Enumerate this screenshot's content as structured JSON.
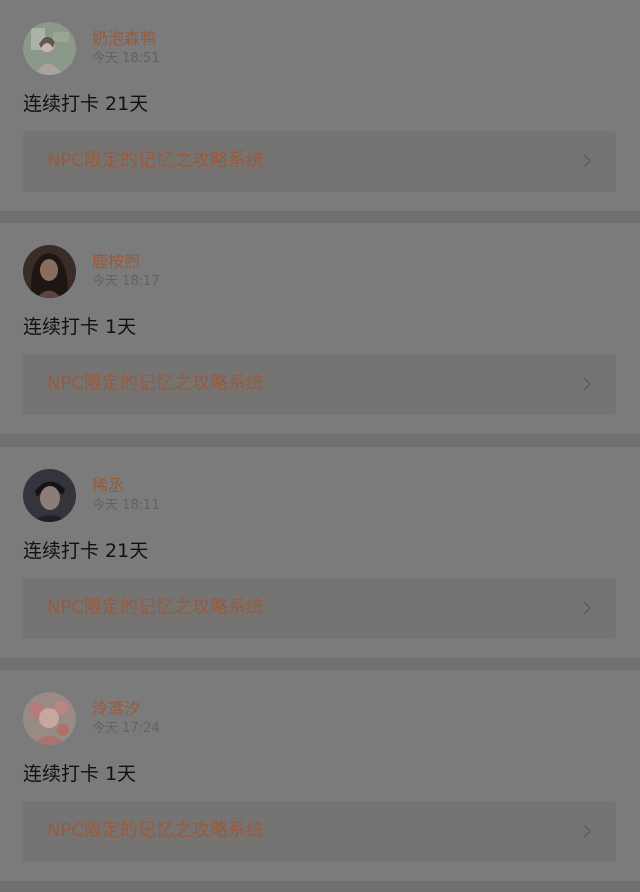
{
  "posts": [
    {
      "username": "奶泡森鸭",
      "time": "今天 18:51",
      "checkin": "连续打卡 21天",
      "book_title": "NPC限定的记忆之攻略系统",
      "avatar_icon": "avatar-illustration-green",
      "avatar_color": "#8a9688"
    },
    {
      "username": "鹿桉煦",
      "time": "今天 18:17",
      "checkin": "连续打卡 1天",
      "book_title": "NPC限定的记忆之攻略系统",
      "avatar_icon": "avatar-photo-dark",
      "avatar_color": "#3b2e2a"
    },
    {
      "username": "稀丞",
      "time": "今天 18:11",
      "checkin": "连续打卡 21天",
      "book_title": "NPC限定的记忆之攻略系统",
      "avatar_icon": "avatar-photo-boy",
      "avatar_color": "#2f2f36"
    },
    {
      "username": "泠鸢汐",
      "time": "今天 17:24",
      "checkin": "连续打卡 1天",
      "book_title": "NPC限定的记忆之攻略系统",
      "avatar_icon": "avatar-illustration-pink",
      "avatar_color": "#a27f7a"
    }
  ],
  "colors": {
    "overlay_bg": "#707070",
    "card_bg": "#7b7b7b",
    "username": "#985a3c",
    "book_title": "#985a3c"
  }
}
